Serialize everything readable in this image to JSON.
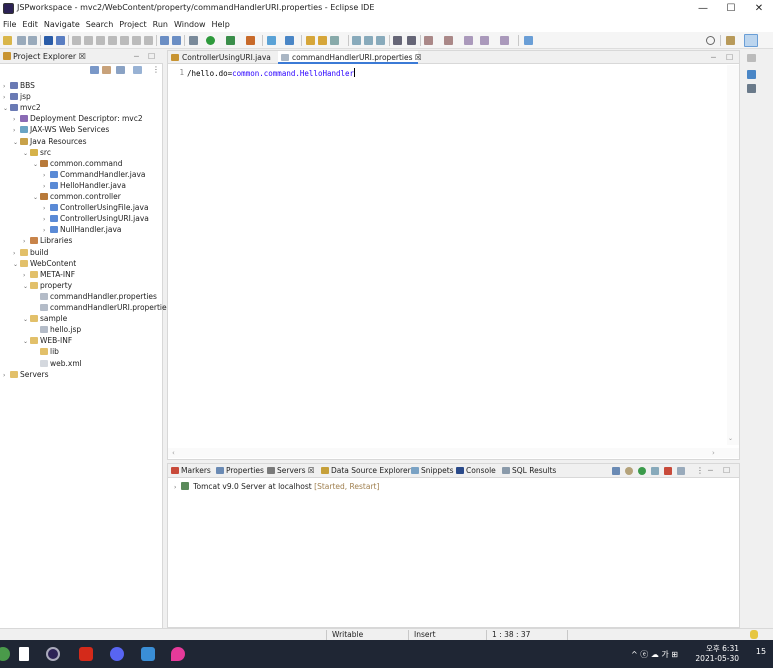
{
  "window": {
    "title": "JSPworkspace - mvc2/WebContent/property/commandHandlerURI.properties - Eclipse IDE",
    "minimize": "—",
    "maximize": "☐",
    "close": "✕"
  },
  "menubar": [
    "File",
    "Edit",
    "Navigate",
    "Search",
    "Project",
    "Run",
    "Window",
    "Help"
  ],
  "explorer": {
    "title": "Project Explorer ☒",
    "tree": [
      {
        "label": "BBS",
        "depth": 0,
        "arrow": "›",
        "icon": "project"
      },
      {
        "label": "jsp",
        "depth": 0,
        "arrow": "›",
        "icon": "project"
      },
      {
        "label": "mvc2",
        "depth": 0,
        "arrow": "⌄",
        "icon": "project"
      },
      {
        "label": "Deployment Descriptor: mvc2",
        "depth": 1,
        "arrow": "›",
        "icon": "descriptor"
      },
      {
        "label": "JAX-WS Web Services",
        "depth": 1,
        "arrow": "›",
        "icon": "ws"
      },
      {
        "label": "Java Resources",
        "depth": 1,
        "arrow": "⌄",
        "icon": "resources"
      },
      {
        "label": "src",
        "depth": 2,
        "arrow": "⌄",
        "icon": "srcfolder"
      },
      {
        "label": "common.command",
        "depth": 3,
        "arrow": "⌄",
        "icon": "package"
      },
      {
        "label": "CommandHandler.java",
        "depth": 4,
        "arrow": "›",
        "icon": "java"
      },
      {
        "label": "HelloHandler.java",
        "depth": 4,
        "arrow": "›",
        "icon": "java"
      },
      {
        "label": "common.controller",
        "depth": 3,
        "arrow": "⌄",
        "icon": "package"
      },
      {
        "label": "ControllerUsingFile.java",
        "depth": 4,
        "arrow": "›",
        "icon": "java"
      },
      {
        "label": "ControllerUsingURI.java",
        "depth": 4,
        "arrow": "›",
        "icon": "java"
      },
      {
        "label": "NullHandler.java",
        "depth": 4,
        "arrow": "›",
        "icon": "java"
      },
      {
        "label": "Libraries",
        "depth": 2,
        "arrow": "›",
        "icon": "libraries"
      },
      {
        "label": "build",
        "depth": 1,
        "arrow": "›",
        "icon": "folder"
      },
      {
        "label": "WebContent",
        "depth": 1,
        "arrow": "⌄",
        "icon": "folder"
      },
      {
        "label": "META-INF",
        "depth": 2,
        "arrow": "›",
        "icon": "folder"
      },
      {
        "label": "property",
        "depth": 2,
        "arrow": "⌄",
        "icon": "folder"
      },
      {
        "label": "commandHandler.properties",
        "depth": 3,
        "arrow": "",
        "icon": "file"
      },
      {
        "label": "commandHandlerURI.properties",
        "depth": 3,
        "arrow": "",
        "icon": "file"
      },
      {
        "label": "sample",
        "depth": 2,
        "arrow": "⌄",
        "icon": "folder"
      },
      {
        "label": "hello.jsp",
        "depth": 3,
        "arrow": "",
        "icon": "file"
      },
      {
        "label": "WEB-INF",
        "depth": 2,
        "arrow": "⌄",
        "icon": "folder"
      },
      {
        "label": "lib",
        "depth": 3,
        "arrow": "",
        "icon": "folder"
      },
      {
        "label": "web.xml",
        "depth": 3,
        "arrow": "",
        "icon": "xml"
      },
      {
        "label": "Servers",
        "depth": 0,
        "arrow": "›",
        "icon": "folder"
      }
    ]
  },
  "editor": {
    "tabs": [
      {
        "label": "ControllerUsingURI.java",
        "active": false
      },
      {
        "label": "commandHandlerURI.properties ☒",
        "active": true
      }
    ],
    "line_number": "1",
    "code_key": "/hello.do",
    "code_eq": "=",
    "code_value": "common.command.HelloHandler"
  },
  "bottom": {
    "tabs": [
      "Markers",
      "Properties",
      "Servers ☒",
      "Data Source Explorer",
      "Snippets",
      "Console",
      "SQL Results"
    ],
    "server_name": "Tomcat v9.0 Server at localhost",
    "server_status": "[Started, Restart]"
  },
  "statusbar": {
    "mode": "Writable",
    "insert": "Insert",
    "position": "1 : 38 : 37"
  },
  "taskbar": {
    "tray": "^ ⓔ ☁ 가 ⊞",
    "time": "오후 6:31",
    "date": "2021-05-30",
    "notifications": "15"
  }
}
